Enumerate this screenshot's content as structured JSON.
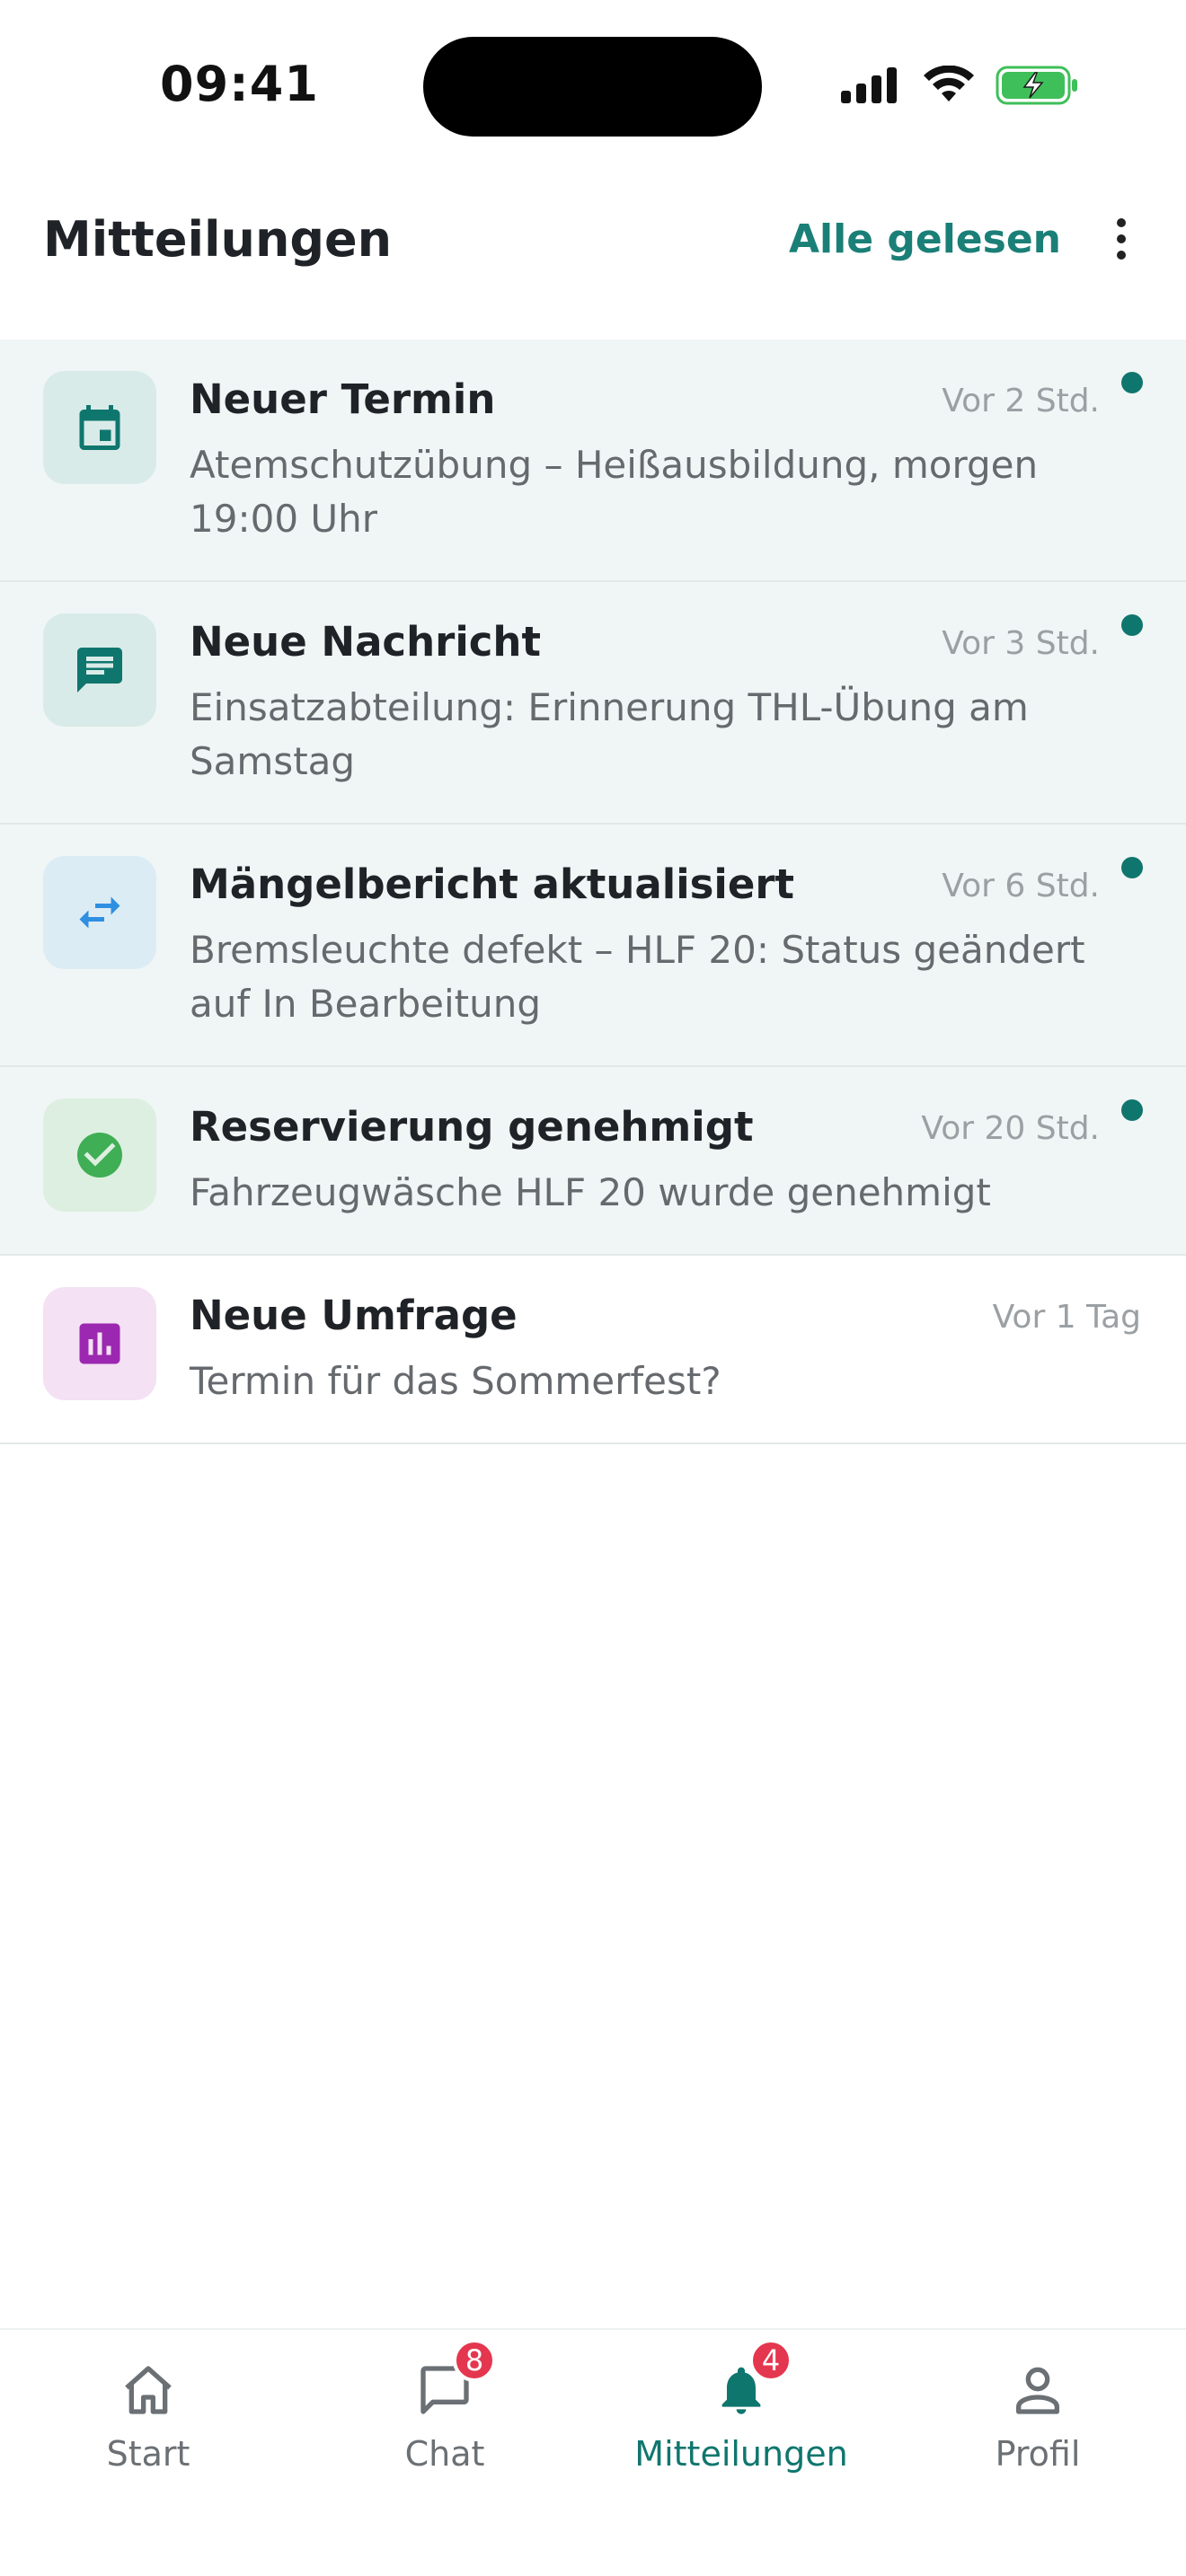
{
  "status_bar": {
    "time": "09:41",
    "icons": [
      "cellular-signal-icon",
      "wifi-icon",
      "battery-charging-icon"
    ]
  },
  "header": {
    "title": "Mitteilungen",
    "mark_all_read_label": "Alle gelesen",
    "more_icon": "more-vertical-icon"
  },
  "notifications": [
    {
      "title": "Neuer Termin",
      "time": "Vor 2 Std.",
      "body": "Atemschutzübung – Heißausbildung, morgen 19:00 Uhr",
      "icon": "calendar-icon",
      "icon_color": "#0f766e",
      "tile_color": "#d9ebe8",
      "unread": true
    },
    {
      "title": "Neue Nachricht",
      "time": "Vor 3 Std.",
      "body": "Einsatzabteilung: Erinnerung THL-Übung am Samstag",
      "icon": "message-icon",
      "icon_color": "#0f766e",
      "tile_color": "#d9ebe8",
      "unread": true
    },
    {
      "title": "Mängelbericht aktualisiert",
      "time": "Vor 6 Std.",
      "body": "Bremsleuchte defekt – HLF 20: Status geändert auf In Bearbeitung",
      "icon": "swap-arrows-icon",
      "icon_color": "#2f8fe0",
      "tile_color": "#dcecf5",
      "unread": true
    },
    {
      "title": "Reservierung genehmigt",
      "time": "Vor 20 Std.",
      "body": "Fahrzeugwäsche HLF 20 wurde genehmigt",
      "icon": "check-circle-icon",
      "icon_color": "#3fae55",
      "tile_color": "#ddefe0",
      "unread": true
    },
    {
      "title": "Neue Umfrage",
      "time": "Vor 1 Tag",
      "body": "Termin für das Sommerfest?",
      "icon": "poll-icon",
      "icon_color": "#9c27b0",
      "tile_color": "#f4e1f4",
      "unread": false
    }
  ],
  "bottom_nav": {
    "active_color": "#0f766e",
    "badge_color": "#e5364f",
    "items": [
      {
        "label": "Start",
        "icon": "home-icon",
        "badge": null,
        "active": false
      },
      {
        "label": "Chat",
        "icon": "chat-icon",
        "badge": "8",
        "active": false
      },
      {
        "label": "Mitteilungen",
        "icon": "bell-icon",
        "badge": "4",
        "active": true
      },
      {
        "label": "Profil",
        "icon": "person-icon",
        "badge": null,
        "active": false
      }
    ]
  }
}
